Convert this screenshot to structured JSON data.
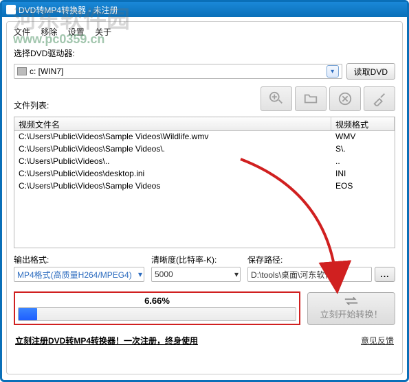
{
  "window": {
    "title": "DVD转MP4转换器 - 未注册"
  },
  "watermark": {
    "text": "河东软件园",
    "url": "www.pc0359.cn"
  },
  "menubar": {
    "file": "文件",
    "remove": "移除",
    "settings": "设置",
    "about": "关于"
  },
  "drive": {
    "label": "选择DVD驱动器:",
    "value": "c: [WIN7]",
    "read_btn": "读取DVD"
  },
  "filelist": {
    "label": "文件列表:",
    "col_name": "视频文件名",
    "col_fmt": "视频格式",
    "rows": [
      {
        "path": "C:\\Users\\Public\\Videos\\Sample Videos\\Wildlife.wmv",
        "fmt": "WMV"
      },
      {
        "path": "C:\\Users\\Public\\Videos\\Sample Videos\\.",
        "fmt": "S\\."
      },
      {
        "path": "C:\\Users\\Public\\Videos\\..",
        "fmt": ".."
      },
      {
        "path": "C:\\Users\\Public\\Videos\\desktop.ini",
        "fmt": "INI"
      },
      {
        "path": "C:\\Users\\Public\\Videos\\Sample Videos",
        "fmt": "EOS"
      }
    ]
  },
  "output": {
    "format_label": "输出格式:",
    "format_value": "MP4格式(高质量H264/MPEG4)",
    "bitrate_label": "清晰度(比特率-K):",
    "bitrate_value": "5000",
    "path_label": "保存路径:",
    "path_value": "D:\\tools\\桌面\\河东软件园\\"
  },
  "progress": {
    "percent_text": "6.66%",
    "percent_value": 6.66
  },
  "actions": {
    "start_label": "立刻开始转换！"
  },
  "footer": {
    "register": "立刻注册DVD转MP4转换器！一次注册，终身使用",
    "feedback": "意见反馈"
  }
}
